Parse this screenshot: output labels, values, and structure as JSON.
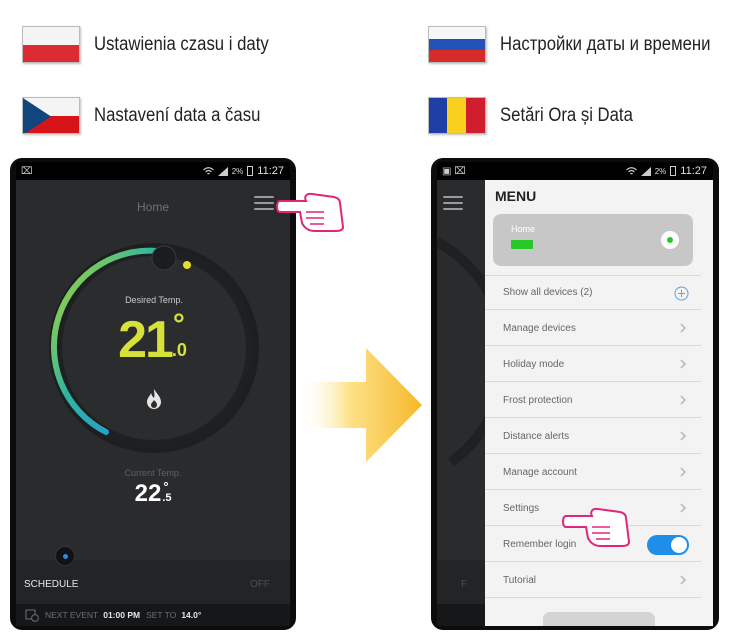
{
  "languages": [
    {
      "code": "pl",
      "label": "Ustawienia czasu i daty"
    },
    {
      "code": "ru",
      "label": "Настройки даты и времени"
    },
    {
      "code": "cz",
      "label": "Nastavení data a času"
    },
    {
      "code": "ro",
      "label": "Setări Ora și Data"
    }
  ],
  "left_phone": {
    "status_time": "11:27",
    "status_battery": "2%",
    "title": "Home",
    "desired_label": "Desired Temp.",
    "desired_whole": "21",
    "desired_decimal": ".0",
    "degree": "°",
    "current_label": "Current Temp.",
    "current_whole": "22",
    "current_decimal": ".5",
    "schedule_label": "SCHEDULE",
    "schedule_state": "OFF",
    "next_event_label": "NEXT EVENT",
    "next_event_time": "01:00 PM",
    "set_to_label": "SET TO",
    "set_to_value": "14.0°"
  },
  "right_phone": {
    "status_time": "11:27",
    "status_battery": "2%",
    "menu_title": "MENU",
    "home_card_label": "Home",
    "behind_off": "F",
    "items": [
      {
        "label": "Show all devices (2)",
        "control": "plus"
      },
      {
        "label": "Manage devices",
        "control": "chevron"
      },
      {
        "label": "Holiday mode",
        "control": "chevron"
      },
      {
        "label": "Frost protection",
        "control": "chevron"
      },
      {
        "label": "Distance alerts",
        "control": "chevron"
      },
      {
        "label": "Manage account",
        "control": "chevron"
      },
      {
        "label": "Settings",
        "control": "chevron"
      },
      {
        "label": "Remember login",
        "control": "toggle",
        "toggle_on": true
      },
      {
        "label": "Tutorial",
        "control": "chevron"
      }
    ]
  },
  "colors": {
    "accent_yellow": "#d6e23a",
    "accent_pink": "#e0267a",
    "toggle_blue": "#1e8ee8",
    "arrow_orange": "#f6b82a"
  },
  "icons": [
    "pointing-hand-icon",
    "hamburger-menu-icon",
    "flame-icon",
    "chevron-right-icon",
    "plus-circle-icon",
    "battery-icon",
    "wifi-icon",
    "signal-icon",
    "clock-icon"
  ]
}
